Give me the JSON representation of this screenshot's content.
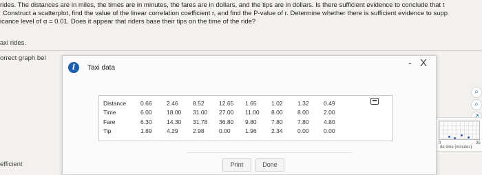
{
  "question": {
    "line1": "rides. The distances are in miles, the times are in minutes, the fares are in dollars, and the tips are in dollars. Is there sufficient evidence to conclude that t",
    "line2": "Construct a scatterplot, find the value of the linear correlation coefficient r, and find the P-value of r. Determine whether there is sufficient evidence to supp",
    "line3": "icance level of α = 0.01. Does it appear that riders base their tips on the time of the ride?"
  },
  "background": {
    "taxi_label": "axi rides.",
    "correct_label": "orrect graph bel",
    "efficient_label": "efficient"
  },
  "graph_thumb": {
    "x_min": "0",
    "x_max": "35",
    "x_label": "de time (minutes)"
  },
  "dialog": {
    "title": "Taxi data",
    "minimize_glyph": "-",
    "close_glyph": "X",
    "table": {
      "rows": [
        {
          "label": "Distance",
          "values": [
            "0.66",
            "2.46",
            "8.52",
            "12.65",
            "1.65",
            "1.02",
            "1.32",
            "0.49"
          ]
        },
        {
          "label": "Time",
          "values": [
            "6.00",
            "18.00",
            "31.00",
            "27.00",
            "11.00",
            "8.00",
            "8.00",
            "2.00"
          ]
        },
        {
          "label": "Fare",
          "values": [
            "6.30",
            "14.30",
            "31.78",
            "36.80",
            "9.80",
            "7.80",
            "7.80",
            "4.80"
          ]
        },
        {
          "label": "Tip",
          "values": [
            "1.89",
            "4.29",
            "2.98",
            "0.00",
            "1.96",
            "2.34",
            "0.00",
            "0.00"
          ]
        }
      ]
    },
    "buttons": {
      "print": "Print",
      "done": "Done"
    }
  },
  "icons": {
    "info": "info-icon",
    "copy": "copy-data-icon",
    "zoom_in": "zoom-in-icon",
    "zoom_out": "zoom-out-icon",
    "external": "external-link-icon"
  },
  "colors": {
    "info_blue": "#1a5fb4",
    "background": "#f2f1ee",
    "dialog_bg": "#fbfbfb"
  }
}
